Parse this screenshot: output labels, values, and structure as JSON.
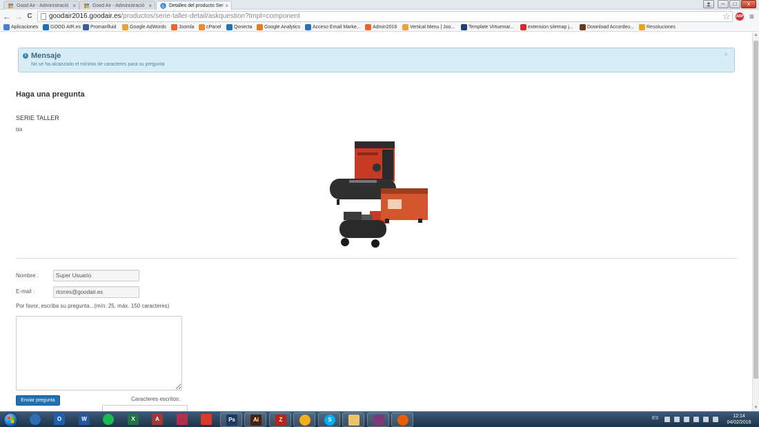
{
  "browser": {
    "tabs": [
      {
        "title": "Good Air - Administració",
        "active": false
      },
      {
        "title": "Good Air - Administració",
        "active": false
      },
      {
        "title": "Detalles del producto Ser",
        "active": true
      }
    ],
    "tab_close_glyph": "×",
    "url_domain": "goodair2016.goodair.es",
    "url_path": "/productos/serie-taller-detail/askquestion?tmpl=component",
    "back_glyph": "←",
    "forward_glyph": "→",
    "reload_glyph": "C",
    "star_glyph": "☆",
    "extension_label": "ABP",
    "menu_glyph": "≡",
    "window_controls": {
      "minimize": "–",
      "maximize": "□",
      "close": "x"
    }
  },
  "bookmarks": [
    {
      "label": "Aplicaciones",
      "icon": "apps-grid-icon",
      "color": "#4a7fd4"
    },
    {
      "label": "GOOD AIR.es",
      "icon": "goodair-icon",
      "color": "#1a6fc1"
    },
    {
      "label": "Promanfluid",
      "icon": "promanfluid-icon",
      "color": "#3a5fa0"
    },
    {
      "label": "Google AdWords",
      "icon": "google-icon",
      "color": "#e8a23a"
    },
    {
      "label": "Joomla",
      "icon": "joomla-icon",
      "color": "#f0642a"
    },
    {
      "label": "cPanel",
      "icon": "cpanel-icon",
      "color": "#f08a2a"
    },
    {
      "label": "Qonecta",
      "icon": "qonecta-icon",
      "color": "#1e73be"
    },
    {
      "label": "Google Analytics",
      "icon": "analytics-icon",
      "color": "#e87a1e"
    },
    {
      "label": "Acceso Email Marke...",
      "icon": "email-marketing-icon",
      "color": "#2a6fbf"
    },
    {
      "label": "Admin2016",
      "icon": "joomla-icon",
      "color": "#f0642a"
    },
    {
      "label": "Vertical Menu | Joo...",
      "icon": "vertical-menu-icon",
      "color": "#e8a23a"
    },
    {
      "label": "Template Virtuemar...",
      "icon": "sj-icon",
      "color": "#1d3f7a"
    },
    {
      "label": "extension sitemap j...",
      "icon": "youtube-icon",
      "color": "#d62a2a"
    },
    {
      "label": "Download Accordeo...",
      "icon": "download-icon",
      "color": "#6a3a1a"
    },
    {
      "label": "Resoluciones",
      "icon": "resoluciones-icon",
      "color": "#f0a020"
    }
  ],
  "alert": {
    "title": "Mensaje",
    "message": "No se ha alcanzado el mínimo de caracteres para su pregunta",
    "close_glyph": "×",
    "info_glyph": "i"
  },
  "page": {
    "heading": "Haga una pregunta",
    "product_name": "SERIE TALLER",
    "product_description": "bla"
  },
  "form": {
    "name_label": "Nombre :",
    "name_value": "Super Usuario",
    "email_label": "E-mail :",
    "email_value": "rtorres@goodair.es",
    "question_hint": "Por favor, escriba su pregunta...(mín. 25, máx. 150 caracteres)",
    "question_value": "",
    "submit_label": "Enviar pregunta",
    "chars_label": "Caracteres escritos:"
  },
  "taskbar": {
    "apps": [
      {
        "name": "arcgis-icon",
        "label": "",
        "color": "#2f6db5"
      },
      {
        "name": "outlook-icon",
        "label": "O",
        "color": "#1f5fb0"
      },
      {
        "name": "word-icon",
        "label": "W",
        "color": "#2b579a"
      },
      {
        "name": "spotify-icon",
        "label": "",
        "color": "#1db954"
      },
      {
        "name": "excel-icon",
        "label": "X",
        "color": "#217346"
      },
      {
        "name": "access-icon",
        "label": "A",
        "color": "#a4373a"
      },
      {
        "name": "app-icon",
        "label": "",
        "color": "#b03050"
      },
      {
        "name": "acrobat-icon",
        "label": "",
        "color": "#d83b2a"
      },
      {
        "name": "photoshop-icon",
        "label": "Ps",
        "color": "#1c3a5e"
      },
      {
        "name": "illustrator-icon",
        "label": "Ai",
        "color": "#4a2208"
      },
      {
        "name": "filezilla-icon",
        "label": "Z",
        "color": "#b8241b"
      },
      {
        "name": "chrome-icon",
        "label": "",
        "color": "#f2b01e"
      },
      {
        "name": "skype-icon",
        "label": "S",
        "color": "#00aff0"
      },
      {
        "name": "folder-icon",
        "label": "",
        "color": "#e9c46a"
      },
      {
        "name": "winrar-icon",
        "label": "",
        "color": "#7a3a7a"
      },
      {
        "name": "firefox-icon",
        "label": "",
        "color": "#e66000"
      }
    ],
    "tray_lang": "ES",
    "clock_time": "12:14",
    "clock_date": "04/02/2016"
  }
}
